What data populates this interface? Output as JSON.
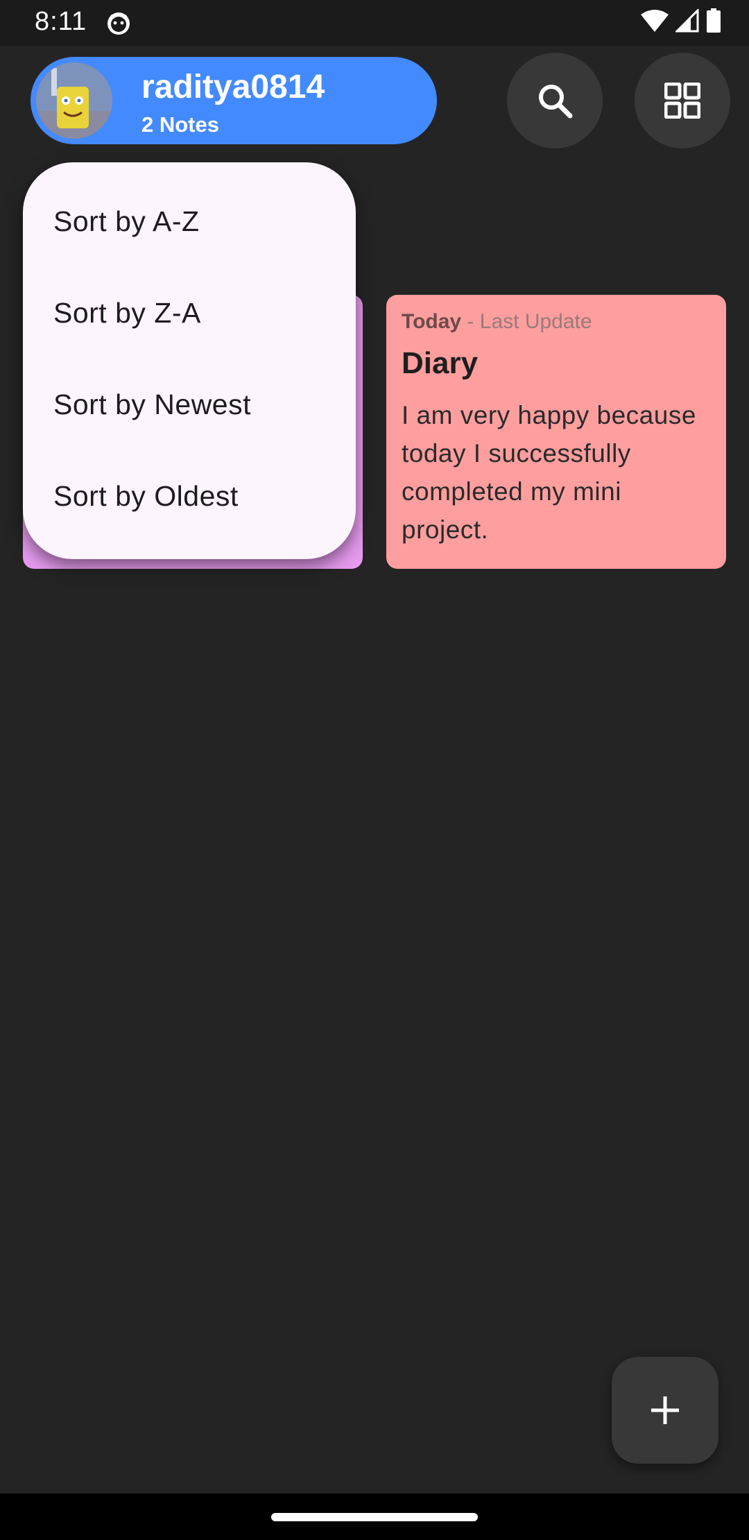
{
  "status_bar": {
    "time": "8:11",
    "icons": [
      "android-debug-icon",
      "wifi-icon",
      "signal-icon",
      "battery-icon"
    ]
  },
  "profile": {
    "username": "raditya0814",
    "notes_count": "2 Notes",
    "pill_color": "#448aff"
  },
  "toolbar": {
    "search_icon": "search-icon",
    "layout_icon": "grid-view-icon"
  },
  "sort_menu": {
    "items": [
      "Sort by A-Z",
      "Sort by Z-A",
      "Sort by Newest",
      "Sort by Oldest"
    ]
  },
  "notes": [
    {
      "color": "#e89bf0"
    },
    {
      "date_label": "Today",
      "date_suffix": " - Last Update",
      "title": "Diary",
      "body": "I am very happy because today I successfully completed my mini project.",
      "color": "#ff9e9e"
    }
  ],
  "fab": {
    "icon": "plus-icon"
  },
  "colors": {
    "background": "#242424",
    "button_bg": "#383838",
    "menu_bg": "#fdf5fd"
  }
}
